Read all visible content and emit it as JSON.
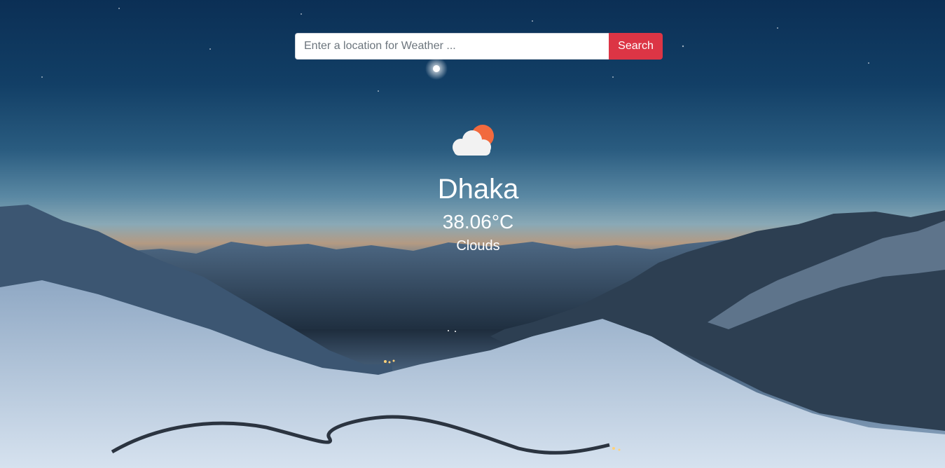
{
  "search": {
    "placeholder": "Enter a location for Weather ...",
    "value": "",
    "button_label": "Search"
  },
  "weather": {
    "icon": "cloud-sun-icon",
    "city": "Dhaka",
    "temperature": "38.06°C",
    "condition": "Clouds"
  },
  "colors": {
    "button": "#dc3545",
    "sun": "#f26a3e",
    "cloud": "#f2f2f2"
  }
}
